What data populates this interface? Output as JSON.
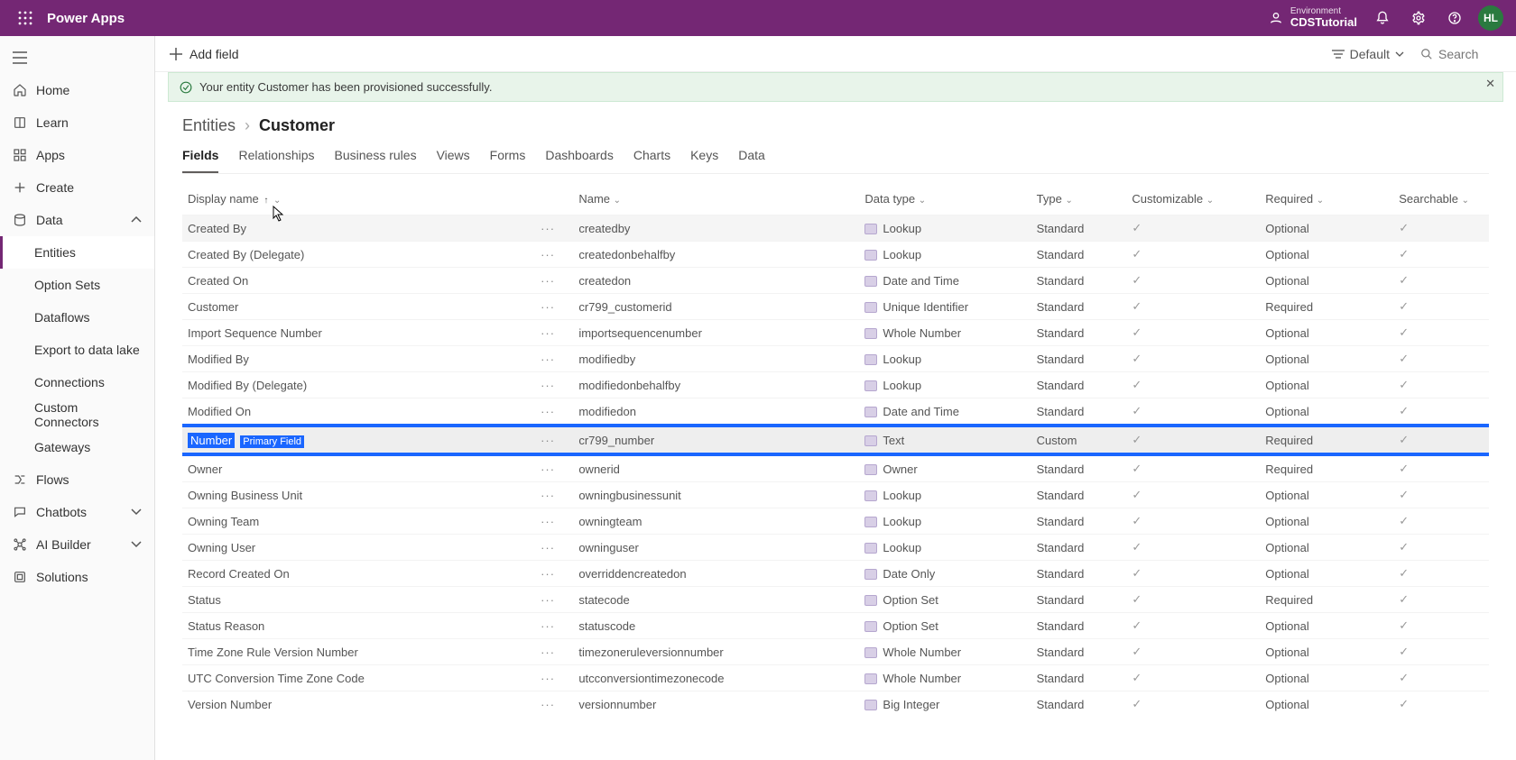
{
  "topbar": {
    "brand": "Power Apps",
    "env_label": "Environment",
    "env_name": "CDSTutorial",
    "avatar_initials": "HL"
  },
  "leftnav": {
    "items": [
      {
        "icon": "home",
        "label": "Home"
      },
      {
        "icon": "learn",
        "label": "Learn"
      },
      {
        "icon": "apps",
        "label": "Apps"
      },
      {
        "icon": "plus",
        "label": "Create"
      },
      {
        "icon": "data",
        "label": "Data",
        "expanded": true,
        "children": [
          {
            "label": "Entities",
            "active": true
          },
          {
            "label": "Option Sets"
          },
          {
            "label": "Dataflows"
          },
          {
            "label": "Export to data lake"
          },
          {
            "label": "Connections"
          },
          {
            "label": "Custom Connectors"
          },
          {
            "label": "Gateways"
          }
        ]
      },
      {
        "icon": "flows",
        "label": "Flows"
      },
      {
        "icon": "chat",
        "label": "Chatbots",
        "chev": true
      },
      {
        "icon": "ai",
        "label": "AI Builder",
        "chev": true
      },
      {
        "icon": "sol",
        "label": "Solutions"
      }
    ]
  },
  "cmdbar": {
    "add_field": "Add field",
    "view_label": "Default",
    "search_placeholder": "Search"
  },
  "banner": {
    "text": "Your entity Customer has been provisioned successfully."
  },
  "breadcrumb": {
    "parent": "Entities",
    "current": "Customer"
  },
  "tabs": [
    "Fields",
    "Relationships",
    "Business rules",
    "Views",
    "Forms",
    "Dashboards",
    "Charts",
    "Keys",
    "Data"
  ],
  "active_tab": 0,
  "columns": {
    "display_name": "Display name",
    "name": "Name",
    "data_type": "Data type",
    "type": "Type",
    "customizable": "Customizable",
    "required": "Required",
    "searchable": "Searchable"
  },
  "rows": [
    {
      "display": "Created By",
      "name": "createdby",
      "dtype": "Lookup",
      "type": "Standard",
      "req": "Optional",
      "hovered": true
    },
    {
      "display": "Created By (Delegate)",
      "name": "createdonbehalfby",
      "dtype": "Lookup",
      "type": "Standard",
      "req": "Optional"
    },
    {
      "display": "Created On",
      "name": "createdon",
      "dtype": "Date and Time",
      "type": "Standard",
      "req": "Optional"
    },
    {
      "display": "Customer",
      "name": "cr799_customerid",
      "dtype": "Unique Identifier",
      "type": "Standard",
      "req": "Required"
    },
    {
      "display": "Import Sequence Number",
      "name": "importsequencenumber",
      "dtype": "Whole Number",
      "type": "Standard",
      "req": "Optional"
    },
    {
      "display": "Modified By",
      "name": "modifiedby",
      "dtype": "Lookup",
      "type": "Standard",
      "req": "Optional"
    },
    {
      "display": "Modified By (Delegate)",
      "name": "modifiedonbehalfby",
      "dtype": "Lookup",
      "type": "Standard",
      "req": "Optional"
    },
    {
      "display": "Modified On",
      "name": "modifiedon",
      "dtype": "Date and Time",
      "type": "Standard",
      "req": "Optional"
    },
    {
      "display": "Number",
      "primary_label": "Primary Field",
      "name": "cr799_number",
      "dtype": "Text",
      "type": "Custom",
      "req": "Required",
      "selected": true
    },
    {
      "display": "Owner",
      "name": "ownerid",
      "dtype": "Owner",
      "type": "Standard",
      "req": "Required"
    },
    {
      "display": "Owning Business Unit",
      "name": "owningbusinessunit",
      "dtype": "Lookup",
      "type": "Standard",
      "req": "Optional"
    },
    {
      "display": "Owning Team",
      "name": "owningteam",
      "dtype": "Lookup",
      "type": "Standard",
      "req": "Optional"
    },
    {
      "display": "Owning User",
      "name": "owninguser",
      "dtype": "Lookup",
      "type": "Standard",
      "req": "Optional"
    },
    {
      "display": "Record Created On",
      "name": "overriddencreatedon",
      "dtype": "Date Only",
      "type": "Standard",
      "req": "Optional"
    },
    {
      "display": "Status",
      "name": "statecode",
      "dtype": "Option Set",
      "type": "Standard",
      "req": "Required"
    },
    {
      "display": "Status Reason",
      "name": "statuscode",
      "dtype": "Option Set",
      "type": "Standard",
      "req": "Optional"
    },
    {
      "display": "Time Zone Rule Version Number",
      "name": "timezoneruleversionnumber",
      "dtype": "Whole Number",
      "type": "Standard",
      "req": "Optional"
    },
    {
      "display": "UTC Conversion Time Zone Code",
      "name": "utcconversiontimezonecode",
      "dtype": "Whole Number",
      "type": "Standard",
      "req": "Optional"
    },
    {
      "display": "Version Number",
      "name": "versionnumber",
      "dtype": "Big Integer",
      "type": "Standard",
      "req": "Optional"
    }
  ]
}
